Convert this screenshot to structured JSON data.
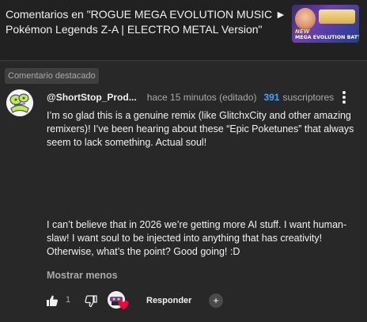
{
  "header": {
    "video_title": "Comentarios en \"ROGUE MEGA EVOLUTION MUSIC ► Pokémon Legends Z-A | ELECTRO METAL Version\"",
    "thumbnail": {
      "caption_new": "NEW",
      "caption": "MEGA EVOLUTION BATTLE!"
    }
  },
  "comment": {
    "pinned_chip": "Comentario destacado",
    "author": "@ShortStop_Prod...",
    "time": "hace 15 minutos (editado)",
    "subscriber_count": "391",
    "subscriber_label": "suscriptores",
    "paragraph_1": "I’m so glad this is a genuine remix (like GlitchxCity and other amazing remixers)! I’ve been hearing about these “Epic Poketunes” that always seem to lack something. Actual soul!",
    "paragraph_2": "I can’t believe that in 2026 we’re getting more AI stuff. I want human-slaw! I want soul to be injected into anything that has creativity! Otherwise, what’s the point? Good going! :D",
    "show_less": "Mostrar menos",
    "like_count": "1",
    "reply_label": "Responder"
  },
  "colors": {
    "background": "#282828",
    "link_blue": "#3ea6ff",
    "heart_red": "#ff0033"
  },
  "icons": [
    "kebab-menu-icon",
    "thumbs-up-icon",
    "thumbs-down-icon",
    "creator-heart-icon",
    "ai-icon"
  ]
}
